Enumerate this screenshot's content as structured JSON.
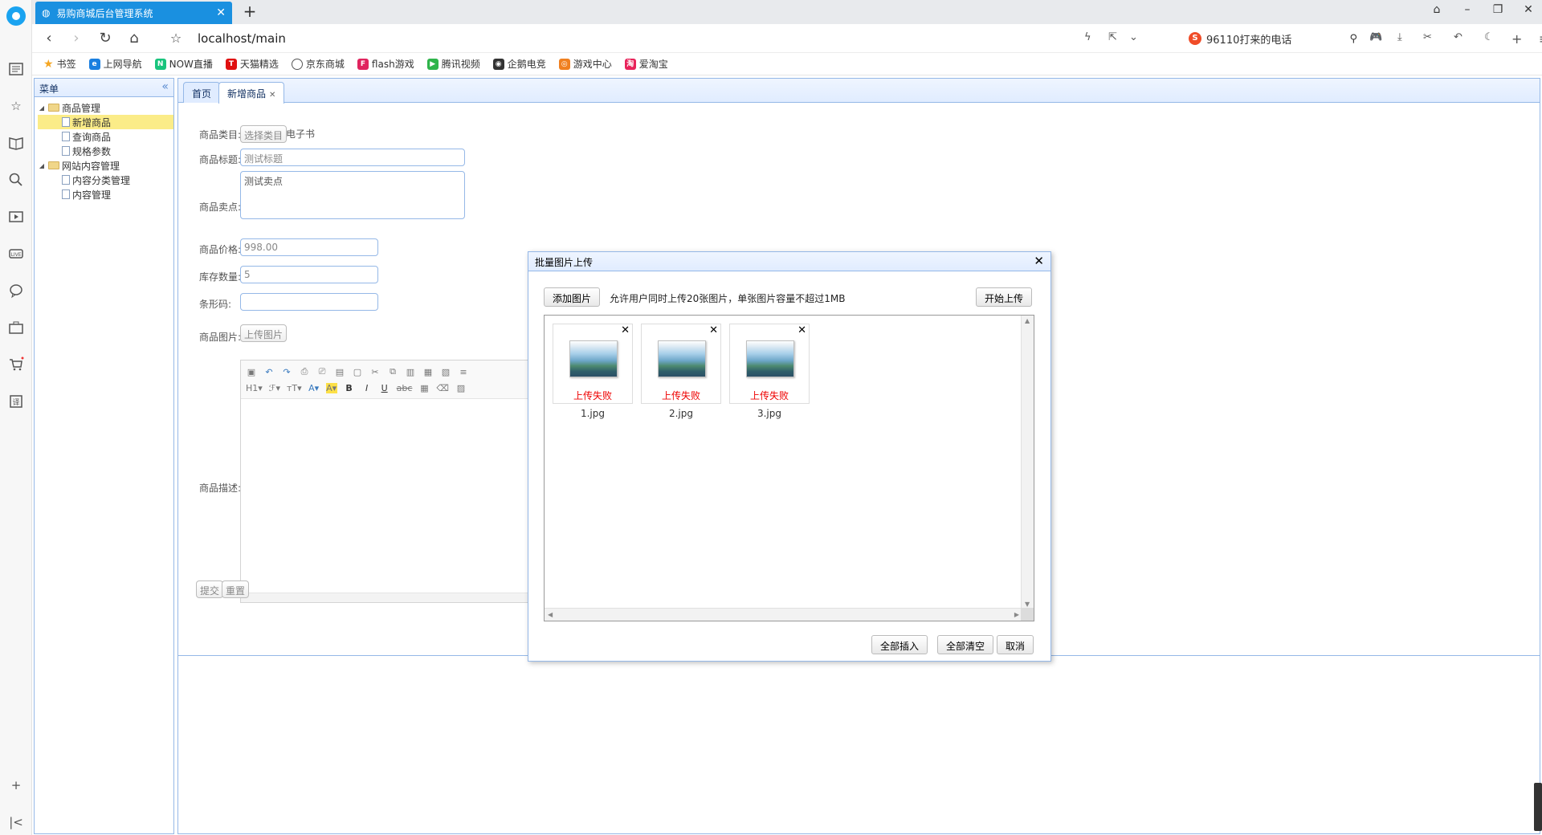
{
  "browser": {
    "tab_title": "易购商城后台管理系统",
    "url": "localhost/main",
    "search_text": "96110打来的电话",
    "bookmarks_label": "书签",
    "bookmarks": [
      "上网导航",
      "NOW直播",
      "天猫精选",
      "京东商城",
      "flash游戏",
      "腾讯视频",
      "企鹅电竞",
      "游戏中心",
      "爱淘宝"
    ]
  },
  "menu": {
    "title": "菜单",
    "groups": [
      {
        "label": "商品管理",
        "items": [
          "新增商品",
          "查询商品",
          "规格参数"
        ]
      },
      {
        "label": "网站内容管理",
        "items": [
          "内容分类管理",
          "内容管理"
        ]
      }
    ],
    "selected": "新增商品"
  },
  "content_tabs": [
    "首页",
    "新增商品"
  ],
  "form": {
    "category_label": "商品类目:",
    "category_button": "选择类目",
    "category_value": "电子书",
    "title_label": "商品标题:",
    "title_value": "测试标题",
    "sell_point_label": "商品卖点:",
    "sell_point_value": "测试卖点",
    "price_label": "商品价格:",
    "price_value": "998.00",
    "stock_label": "库存数量:",
    "stock_value": "5",
    "barcode_label": "条形码:",
    "barcode_value": "",
    "image_label": "商品图片:",
    "image_button": "上传图片",
    "desc_label": "商品描述:",
    "submit": "提交",
    "reset": "重置"
  },
  "dialog": {
    "title": "批量图片上传",
    "add_button": "添加图片",
    "note": "允许用户同时上传20张图片，单张图片容量不超过1MB",
    "start_button": "开始上传",
    "files": [
      {
        "name": "1.jpg",
        "status": "上传失败"
      },
      {
        "name": "2.jpg",
        "status": "上传失败"
      },
      {
        "name": "3.jpg",
        "status": "上传失败"
      }
    ],
    "insert_all": "全部插入",
    "clear_all": "全部清空",
    "cancel": "取消"
  }
}
